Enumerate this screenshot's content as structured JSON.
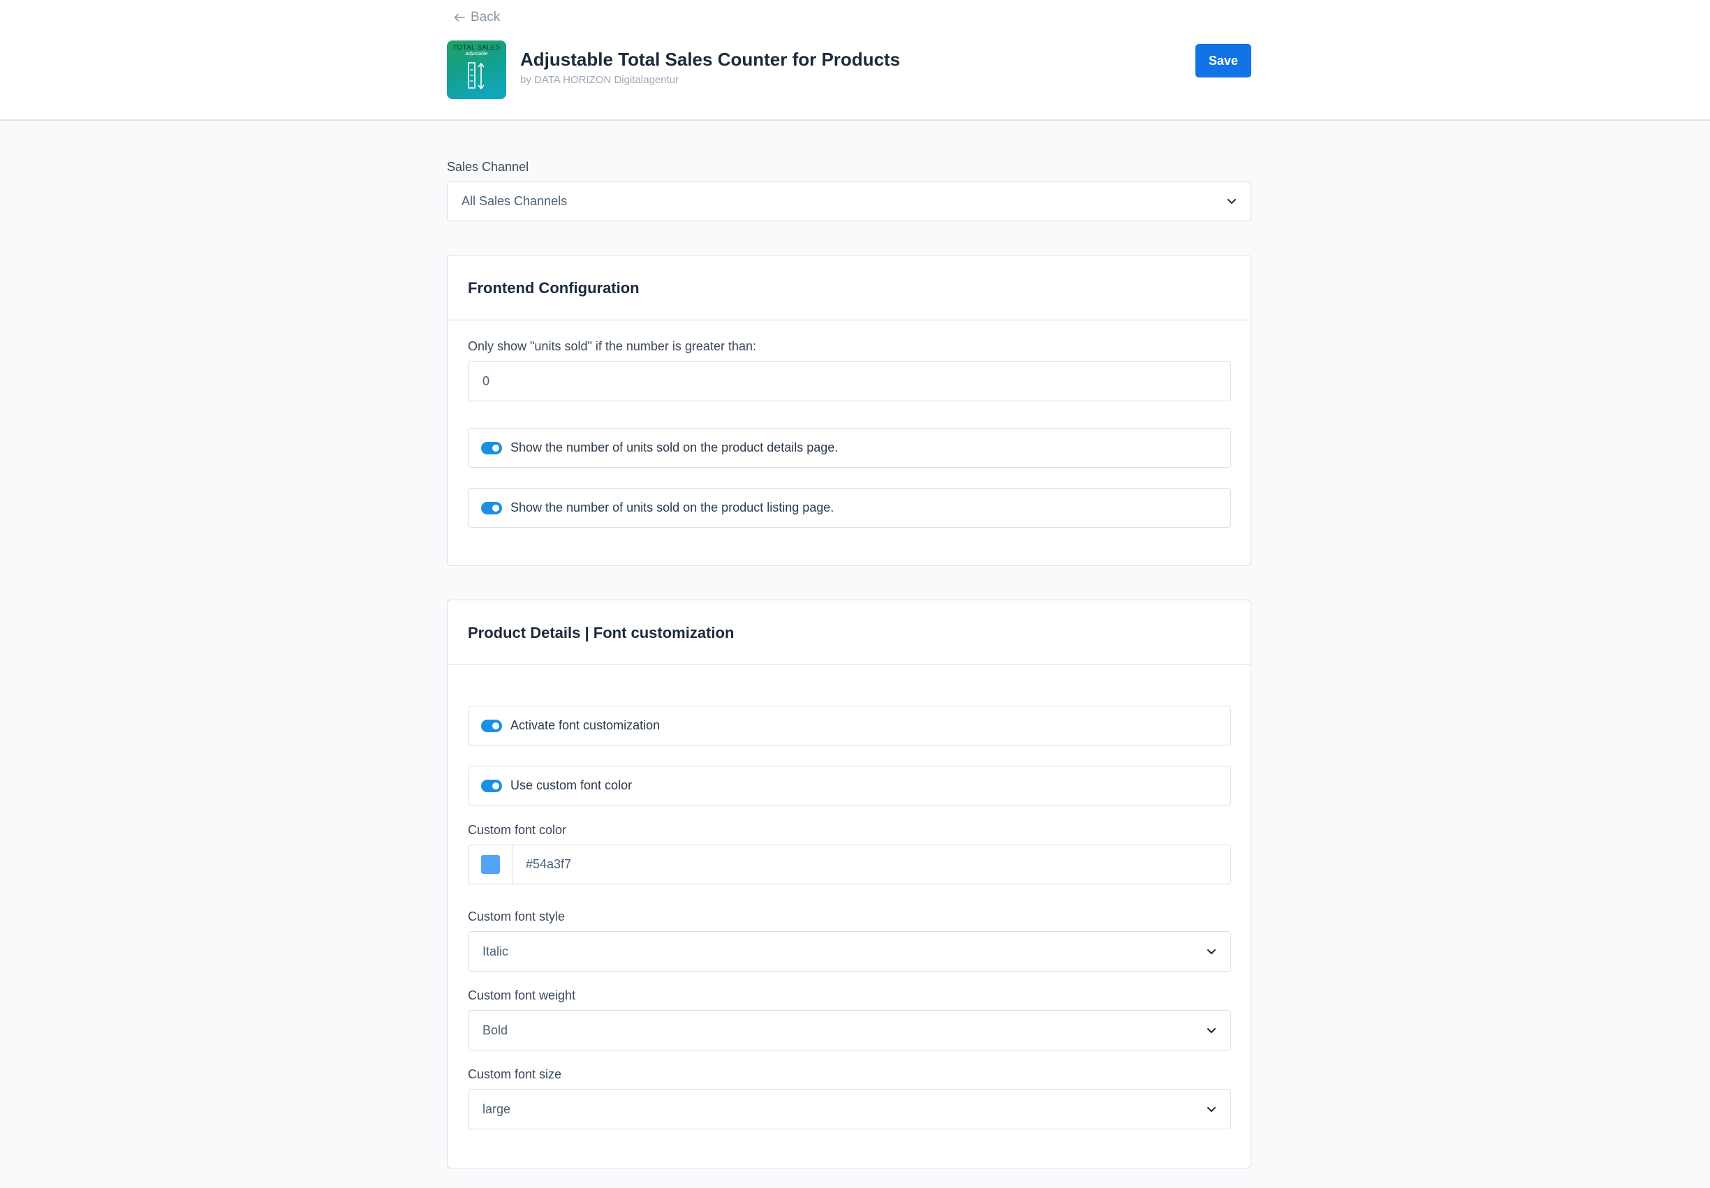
{
  "header": {
    "back_label": "Back",
    "app_title": "Adjustable Total Sales Counter for Products",
    "app_author": "by DATA HORIZON Digitalagentur",
    "save_label": "Save",
    "icon_text_top": "TOTAL SALES",
    "icon_text_sub": "adjustable"
  },
  "sales_channel": {
    "label": "Sales Channel",
    "value": "All Sales Channels"
  },
  "frontend_config": {
    "title": "Frontend Configuration",
    "threshold_label": "Only show \"units sold\" if the number is greater than:",
    "threshold_value": "0",
    "toggles": [
      {
        "label": "Show the number of units sold on the product details page.",
        "enabled": true
      },
      {
        "label": "Show the number of units sold on the product listing page.",
        "enabled": true
      }
    ]
  },
  "font_customization": {
    "title": "Product Details | Font customization",
    "toggles": [
      {
        "label": "Activate font customization",
        "enabled": true
      },
      {
        "label": "Use custom font color",
        "enabled": true
      }
    ],
    "color_label": "Custom font color",
    "color_value": "#54a3f7",
    "style_label": "Custom font style",
    "style_value": "Italic",
    "weight_label": "Custom font weight",
    "weight_value": "Bold",
    "size_label": "Custom font size",
    "size_value": "large"
  },
  "colors": {
    "accent": "#1273e6",
    "toggle_on": "#1a8fe3",
    "swatch": "#54a3f7"
  }
}
